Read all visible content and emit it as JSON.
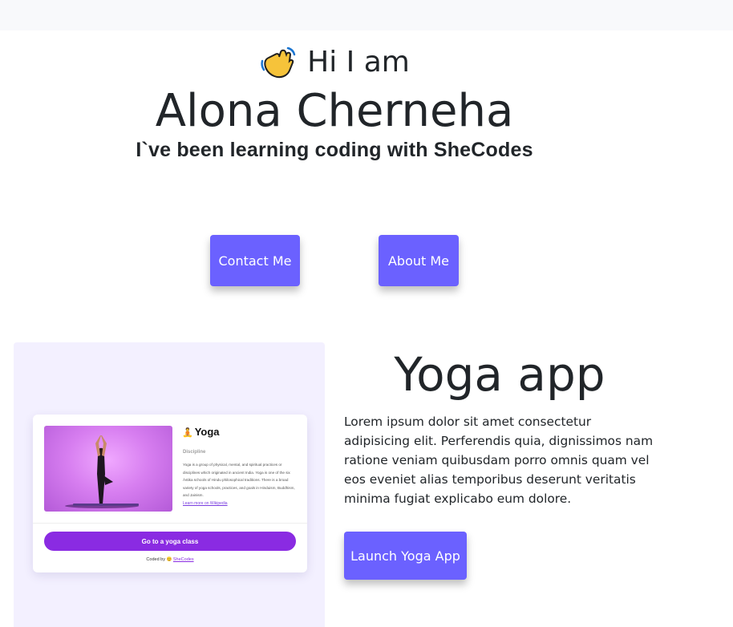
{
  "hero": {
    "greeting_emoji": "👋",
    "greeting": "Hi I am",
    "name": "Alona Cherneha",
    "tagline": "I`ve been learning coding with SheCodes"
  },
  "buttons": {
    "contact": "Contact Me",
    "about": "About Me"
  },
  "project": {
    "title": "Yoga app",
    "description": "Lorem ipsum dolor sit amet consectetur adipisicing elit. Perferendis quia, dignissimos nam ratione veniam quibusdam porro omnis quam vel eos eveniet alias temporibus deserunt veritatis minima fugiat explicabo eum dolore.",
    "launch_label": "Launch Yoga App"
  },
  "preview_card": {
    "title_emoji": "🧘",
    "title": "Yoga",
    "subtitle": "Discipline",
    "description": "Yoga is a group of physical, mental, and spiritual practices or disciplines which originated in ancient India. Yoga is one of the six Āstika schools of Hindu philosophical traditions. There is a broad variety of yoga schools, practices, and goals in Hinduism, Buddhism, and Jainism.",
    "link": "Learn more on Wikipedia",
    "button": "Go to a yoga class",
    "credit_prefix": "Coded by",
    "credit_emoji": "😊",
    "credit_link": "SheCodes"
  },
  "colors": {
    "accent": "#6b61ff",
    "card_button": "#8a2be2",
    "panel_bg": "#f3f0ff"
  }
}
